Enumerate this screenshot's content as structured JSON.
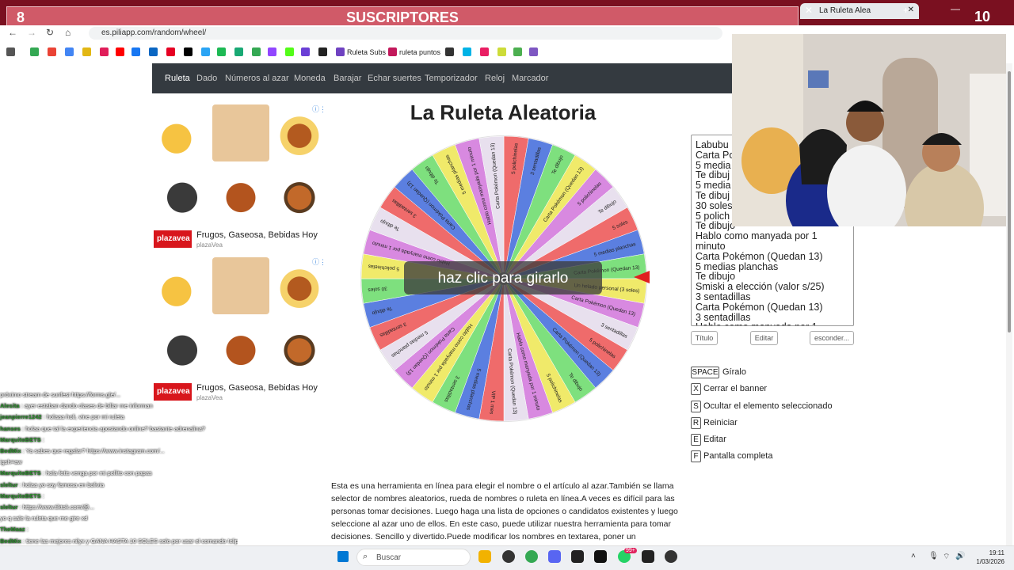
{
  "banner": {
    "left_count": "8",
    "title": "SUSCRIPTORES",
    "right_count": "10"
  },
  "browser": {
    "tab_title": "La Ruleta Alea",
    "url": "es.piliapp.com/random/wheel/",
    "bookmarks": [
      {
        "label": "Ruleta Subs"
      },
      {
        "label": "ruleta puntos"
      }
    ]
  },
  "site_nav": [
    "Ruleta",
    "Dado",
    "Números al azar",
    "Moneda",
    "Barajar",
    "Echar suertes",
    "Temporizador",
    "Reloj",
    "Marcador"
  ],
  "ads": [
    {
      "title": "Frugos, Gaseosa, Bebidas Hoy",
      "source": "plazaVea",
      "logo": "plazavea"
    },
    {
      "title": "Frugos, Gaseosa, Bebidas Hoy",
      "source": "plazaVea",
      "logo": "plazavea"
    }
  ],
  "page_title": "La Ruleta Aleatoria",
  "spin_overlay": "haz clic para girarlo",
  "names_text": [
    "Labubu",
    "Carta Po",
    "5 media",
    "Te dibuj",
    "5 media",
    "Te dibuj",
    "30 soles",
    "5 polich",
    "Te dibujo",
    "Hablo como manyada por 1",
    "minuto",
    "Carta Pokémon (Quedan 13)",
    "5 medias planchas",
    "Te dibujo",
    "Smiski a elección (valor s/25)",
    "3 sentadillas",
    "Carta Pokémon (Quedan 13)",
    "3 sentadillas",
    "Hablo como manyada por 1"
  ],
  "wheel": {
    "slice_colors": [
      "#ef6b6b",
      "#5b7fe0",
      "#7ee07e",
      "#f0ea6a",
      "#d889e0",
      "#e8e0ee"
    ],
    "labels": [
      "5 polichinelas",
      "3 sentadillas",
      "Te dibujo",
      "Carta Pokémon (Quedan 13)",
      "5 polichinelas",
      "Te dibujo",
      "5 soles",
      "5 medias planchas",
      "Carta Pokémon (Quedan 13)",
      "Un helado personal (3 soles)",
      "Carta Pokémon (Quedan 13)",
      "3 sentadillas",
      "5 polichinelas",
      "Carta Pokémon (Quedan 13)",
      "Te dibujo",
      "5 polichinelas",
      "Hablo como manyada por 1 minuto",
      "Carta Pokémon (Quedan 13)",
      "VIP 1 mes",
      "5 medias planchas",
      "3 sentadillas",
      "Hablo como manyada por 1 minuto",
      "Carta Pokémon (Quedan 13)",
      "5 medias planchas",
      "3 sentadillas",
      "Te dibujo",
      "30 soles",
      "5 polichinelas",
      "Hablo como manyada por 1 minuto",
      "Te dibujo",
      "3 sentadillas",
      "Carta Pokémon (Quedan 13)",
      "Te dibujo",
      "5 medias planchas",
      "Hablo como manyada por 1 minuto",
      "Carta Pokémon (Quedan 13)"
    ]
  },
  "buttons": {
    "title": "Título",
    "edit": "Editar",
    "hide": "esconder..."
  },
  "shortcuts": [
    {
      "key": "SPACE",
      "label": "Gíralo"
    },
    {
      "key": "X",
      "label": "Cerrar el banner"
    },
    {
      "key": "S",
      "label": "Ocultar el elemento seleccionado"
    },
    {
      "key": "R",
      "label": "Reiniciar"
    },
    {
      "key": "E",
      "label": "Editar"
    },
    {
      "key": "F",
      "label": "Pantalla completa"
    }
  ],
  "description": "Esta es una herramienta en línea para elegir el nombre o el artículo al azar.También se llama selector de nombres aleatorios, rueda de nombres o ruleta en línea.A veces es difícil para las personas tomar decisiones. Luego haga una lista de opciones o candidatos existentes y luego seleccione al azar uno de ellos. En este caso, puede utilizar nuestra herramienta para tomar decisiones. Sencillo y divertido.Puede modificar los nombres en textarea, poner un",
  "chat": [
    {
      "user": "",
      "msg": "próximo stream de sunfest https://forms.gle/..."
    },
    {
      "user": "Alesita",
      "msg": "ayer estaban dando clases de billar me informan"
    },
    {
      "user": "jeanpierre1242",
      "msg": "holaaa holi, vine por mi ruleta"
    },
    {
      "user": "hanses",
      "msg": "holaa que tal la experiencia apostando online? bastante adrenalina?"
    },
    {
      "user": "MarquitoBETS",
      "msg": ""
    },
    {
      "user": "BedMix",
      "msg": "Ya sabes que regalar? https://www.instagram.com/..."
    },
    {
      "user": "",
      "msg": "igsh=aw"
    },
    {
      "user": "MarquitoBETS",
      "msg": "hola fotis venga por mi pollito con papas"
    },
    {
      "user": "sleltur",
      "msg": "holaa yo soy famosa en bolivia"
    },
    {
      "user": "MarquitoBETS",
      "msg": ""
    },
    {
      "user": "sleltur",
      "msg": "https://www.tiktok.com/@..."
    },
    {
      "user": "",
      "msg": "yo q sale la ruleta que me gire xd"
    },
    {
      "user": "TheMaaz",
      "msg": ""
    },
    {
      "user": "BedMix",
      "msg": "tiene las mejores nilyx y GANA HASTA 10 SOLES solo por usar el comando !clip"
    },
    {
      "user": "",
      "msg": ""
    },
    {
      "user": "jeanpierre1242",
      "msg": ""
    },
    {
      "user": "walinguidecen",
      "msg": "hola"
    }
  ],
  "taskbar": {
    "search": "Buscar",
    "time": "19:11",
    "date": "1/03/2026",
    "badge": "99+"
  }
}
